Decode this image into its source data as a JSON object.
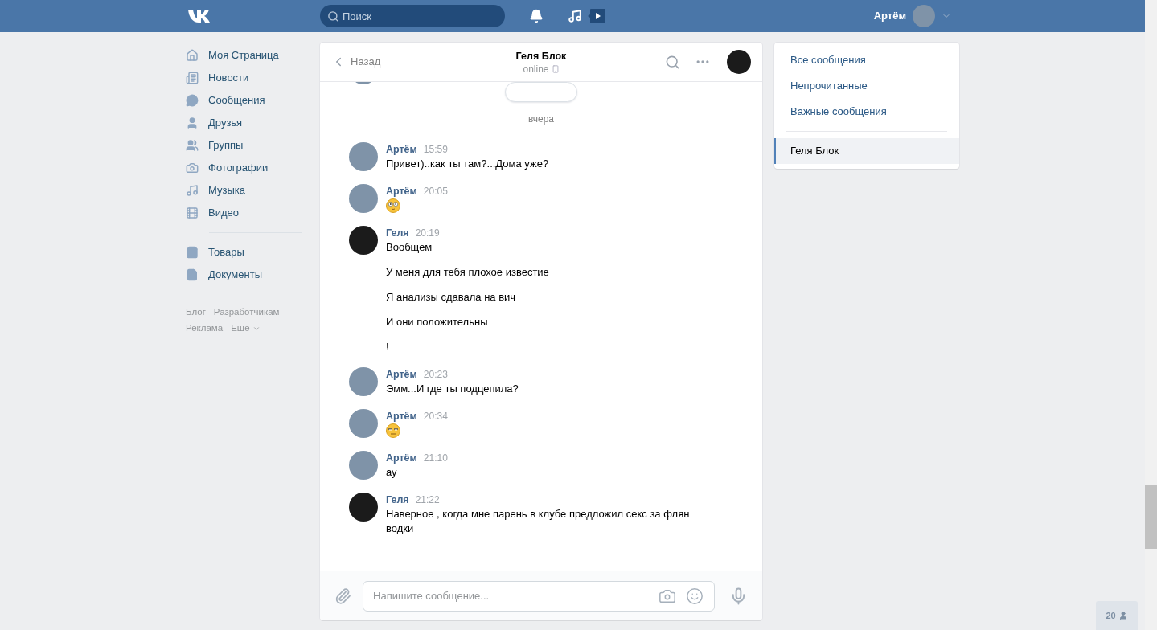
{
  "header": {
    "search": {
      "placeholder": "Поиск"
    },
    "user": {
      "name": "Артём"
    }
  },
  "nav": {
    "items": [
      {
        "label": "Моя Страница"
      },
      {
        "label": "Новости"
      },
      {
        "label": "Сообщения"
      },
      {
        "label": "Друзья"
      },
      {
        "label": "Группы"
      },
      {
        "label": "Фотографии"
      },
      {
        "label": "Музыка"
      },
      {
        "label": "Видео"
      }
    ],
    "extra_items": [
      {
        "label": "Товары"
      },
      {
        "label": "Документы"
      }
    ],
    "footer_links": [
      {
        "label": "Блог",
        "dropdown": false
      },
      {
        "label": "Разработчикам",
        "dropdown": false
      },
      {
        "label": "Реклама",
        "dropdown": false
      },
      {
        "label": "Ещё",
        "dropdown": true
      }
    ]
  },
  "chat": {
    "back": "Назад",
    "title": "Геля Блок",
    "status": "online",
    "date_separator": "вчера",
    "messages": [
      {
        "sender": "Артём",
        "time": "15:59",
        "from_me": true,
        "kind": "text",
        "lines": [
          "Привет)..как ты там?...Дома уже?"
        ]
      },
      {
        "sender": "Артём",
        "time": "20:05",
        "from_me": true,
        "kind": "flushed"
      },
      {
        "sender": "Геля",
        "time": "20:19",
        "from_me": false,
        "kind": "text",
        "lines": [
          "Вообщем",
          "У меня для тебя плохое известие",
          "Я анализы сдавала на вич",
          "И они положительны",
          "!"
        ]
      },
      {
        "sender": "Артём",
        "time": "20:23",
        "from_me": true,
        "kind": "text",
        "lines": [
          "Эмм...И где ты подцепила?"
        ]
      },
      {
        "sender": "Артём",
        "time": "20:34",
        "from_me": true,
        "kind": "smirk"
      },
      {
        "sender": "Артём",
        "time": "21:10",
        "from_me": true,
        "kind": "text",
        "lines": [
          "ау"
        ]
      },
      {
        "sender": "Геля",
        "time": "21:22",
        "from_me": false,
        "kind": "text",
        "lines": [
          "Наверное , когда мне парень в клубе предложил секс за флян водки"
        ]
      }
    ],
    "composer": {
      "placeholder": "Напишите сообщение..."
    }
  },
  "filters": [
    {
      "label": "Все сообщения",
      "selected": false
    },
    {
      "label": "Непрочитанные",
      "selected": false
    },
    {
      "label": "Важные сообщения",
      "selected": false
    }
  ],
  "conversations": [
    {
      "label": "Геля Блок",
      "selected": true
    }
  ],
  "online_friends": {
    "count": "20"
  }
}
